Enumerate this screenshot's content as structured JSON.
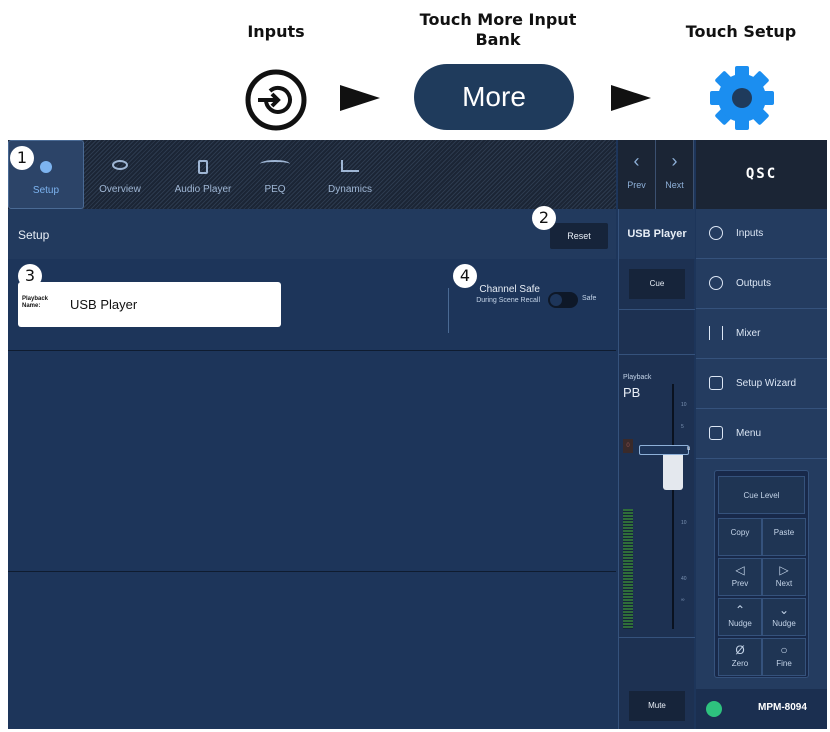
{
  "guide": {
    "step1": "Inputs",
    "step2": "Touch More Input Bank",
    "step3": "Touch Setup",
    "more_label": "More"
  },
  "tabs": [
    {
      "label": "Setup"
    },
    {
      "label": "Overview"
    },
    {
      "label": "Audio Player"
    },
    {
      "label": "PEQ"
    },
    {
      "label": "Dynamics"
    }
  ],
  "nav": {
    "prev": "Prev",
    "next": "Next"
  },
  "brand": "QSC",
  "header": {
    "title": "Setup",
    "reset": "Reset"
  },
  "channel": {
    "name": "USB Player",
    "cue": "Cue",
    "mute": "Mute",
    "section": "Playback",
    "short": "PB",
    "fader_scale": [
      "10",
      "5",
      "u",
      "10",
      "40",
      "∞"
    ],
    "clip": "0"
  },
  "form": {
    "playback_label": "Playback Name:",
    "playback_value": "USB Player",
    "safe_label": "Channel Safe",
    "safe_sub": "During Scene Recall",
    "safe_toggle": "Safe",
    "safe_on": false
  },
  "sidebar": {
    "items": [
      "Inputs",
      "Outputs",
      "Mixer",
      "Setup Wizard",
      "Menu"
    ],
    "device": "MPM-8094"
  },
  "keypad": {
    "cue_level": "Cue Level",
    "copy": "Copy",
    "paste": "Paste",
    "prev": "Prev",
    "next": "Next",
    "nudge_up": "Nudge",
    "nudge_down": "Nudge",
    "zero": "Zero",
    "fine": "Fine"
  },
  "callouts": [
    "1",
    "2",
    "3",
    "4"
  ],
  "colors": {
    "accent": "#7db4f0",
    "bg": "#1d355a",
    "sidebar": "#243c60",
    "wifi": "#2ec27e"
  }
}
